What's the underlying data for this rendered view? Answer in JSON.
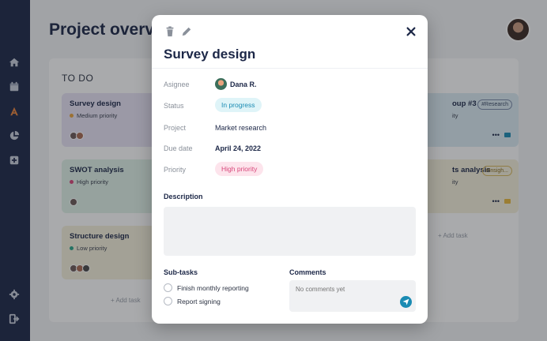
{
  "page": {
    "title": "Project overview"
  },
  "colors": {
    "sidebar": "#1c2747",
    "accent": "#1a8bb3",
    "active_nav": "#e8843c",
    "in_progress_bg": "#dff4f8",
    "in_progress_text": "#1a8bb3",
    "high_priority_bg": "#fde4ec",
    "high_priority_text": "#d8467a"
  },
  "sidebar": {
    "items": [
      {
        "icon": "home-icon",
        "active": false
      },
      {
        "icon": "calendar-icon",
        "active": false
      },
      {
        "icon": "projects-icon",
        "active": true
      },
      {
        "icon": "pie-chart-icon",
        "active": false
      },
      {
        "icon": "add-icon",
        "active": false
      },
      {
        "icon": "settings-icon",
        "active": false
      },
      {
        "icon": "logout-icon",
        "active": false
      }
    ]
  },
  "board": {
    "todo": {
      "title": "TO DO",
      "add_task": "+ Add task",
      "cards": [
        {
          "title": "Survey design",
          "priority": "Medium priority"
        },
        {
          "title": "SWOT analysis",
          "priority": "High priority"
        },
        {
          "title": "Structure design",
          "priority": "Low priority"
        }
      ]
    },
    "right": {
      "add_task": "+ Add task",
      "cards": [
        {
          "title": "oup #3",
          "priority": "ity",
          "tag": "#Research"
        },
        {
          "title": "ts analysis",
          "priority": "ity",
          "tag": "#Insigh..."
        }
      ]
    }
  },
  "modal": {
    "title": "Survey design",
    "fields": {
      "assignee_label": "Asignee",
      "assignee": "Dana R.",
      "status_label": "Status",
      "status": "In progress",
      "project_label": "Project",
      "project": "Market research",
      "due_label": "Due date",
      "due": "April 24, 2022",
      "priority_label": "Priority",
      "priority": "High priority"
    },
    "description_label": "Description",
    "subtasks_label": "Sub-tasks",
    "subtasks": [
      {
        "label": "Finish monthly reporting",
        "done": false
      },
      {
        "label": "Report signing",
        "done": false
      }
    ],
    "comments_label": "Comments",
    "comment_placeholder": "No comments yet"
  }
}
